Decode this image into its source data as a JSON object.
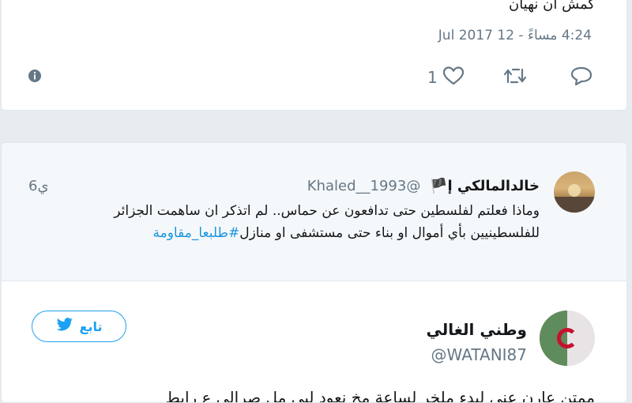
{
  "tweet1": {
    "partial_text": "كمش ان نهيان",
    "timestamp": "4:24 مساءً - 12 Jul 2017",
    "like_count": "1"
  },
  "quoted": {
    "name": "خالدالمالكي إ🏴",
    "handle": "@1993__Khaled",
    "time": "6ي",
    "body_line1": "وماذا فعلتم لفلسطين حتى تدافعون عن حماس.. لم اتذكر ان ساهمت الجزائر",
    "body_line2": "للفلسطينيين بأي أموال او بناء حتى مستشفى او منازل",
    "hashtag": "#طلبعا_مقاومة"
  },
  "user": {
    "name": "وطني الغالي",
    "handle": "@WATANI87",
    "follow_label": "تابع"
  },
  "tweet2": {
    "partial_text": "ممتن عارن عني لبدء ملخر لساعة مخ نعود لبي مل صرالي ع رابط"
  },
  "colors": {
    "accent": "#1da1f2",
    "muted": "#657786",
    "bg": "#e6ecf0"
  }
}
